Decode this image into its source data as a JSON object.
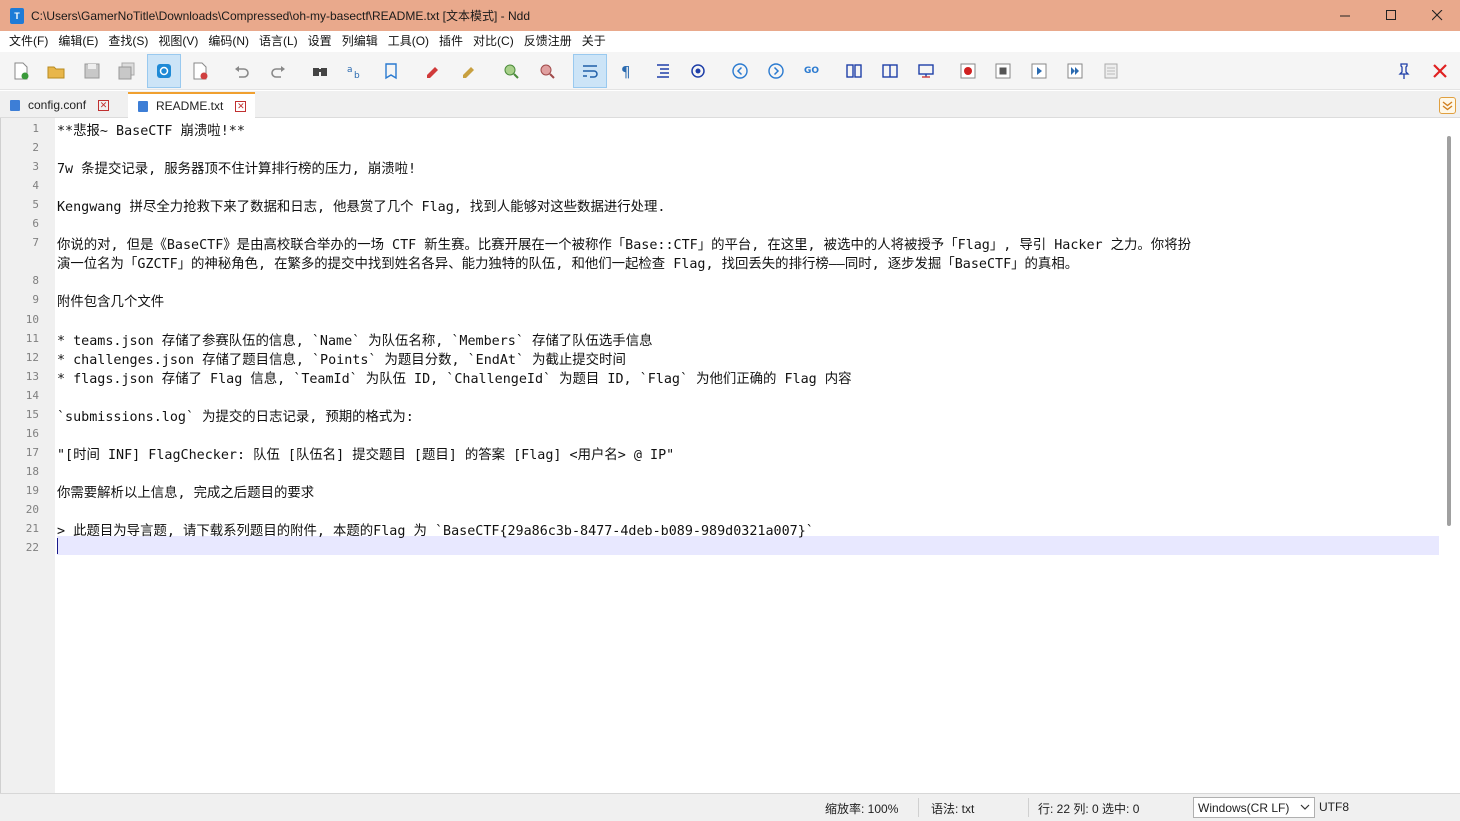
{
  "window": {
    "title": "C:\\Users\\GamerNoTitle\\Downloads\\Compressed\\oh-my-basectf\\README.txt [文本模式] - Ndd",
    "app_icon_label": "T"
  },
  "menu": [
    "文件(F)",
    "编辑(E)",
    "查找(S)",
    "视图(V)",
    "编码(N)",
    "语言(L)",
    "设置",
    "列编辑",
    "工具(O)",
    "插件",
    "对比(C)",
    "反馈注册",
    "关于"
  ],
  "tabs": [
    {
      "label": "config.conf",
      "active": false
    },
    {
      "label": "README.txt",
      "active": true
    }
  ],
  "editor": {
    "line_numbers": [
      "1",
      "2",
      "3",
      "4",
      "5",
      "6",
      "7",
      "",
      "8",
      "9",
      "10",
      "11",
      "12",
      "13",
      "14",
      "15",
      "16",
      "17",
      "18",
      "19",
      "20",
      "21",
      "22"
    ],
    "lines": [
      "**悲报~ BaseCTF 崩溃啦!**",
      "",
      "7w 条提交记录, 服务器顶不住计算排行榜的压力, 崩溃啦!",
      "",
      "Kengwang 拼尽全力抢救下来了数据和日志, 他悬赏了几个 Flag, 找到人能够对这些数据进行处理.",
      "",
      "你说的对, 但是《BaseCTF》是由高校联合举办的一场 CTF 新生赛。比赛开展在一个被称作「Base::CTF」的平台, 在这里, 被选中的人将被授予「Flag」, 导引 Hacker 之力。你将扮",
      "演一位名为「GZCTF」的神秘角色, 在繁多的提交中找到姓名各异、能力独特的队伍, 和他们一起检查 Flag, 找回丢失的排行榜——同时, 逐步发掘「BaseCTF」的真相。",
      "",
      "附件包含几个文件",
      "",
      "* teams.json 存储了参赛队伍的信息, `Name` 为队伍名称, `Members` 存储了队伍选手信息",
      "* challenges.json 存储了题目信息, `Points` 为题目分数, `EndAt` 为截止提交时间",
      "* flags.json 存储了 Flag 信息, `TeamId` 为队伍 ID, `ChallengeId` 为题目 ID, `Flag` 为他们正确的 Flag 内容",
      "",
      "`submissions.log` 为提交的日志记录, 预期的格式为:",
      "",
      "\"[时间 INF] FlagChecker: 队伍 [队伍名] 提交题目 [题目] 的答案 [Flag] <用户名> @ IP\"",
      "",
      "你需要解析以上信息, 完成之后题目的要求",
      "",
      "> 此题目为导言题, 请下载系列题目的附件, 本题的Flag 为 `BaseCTF{29a86c3b-8477-4deb-b089-989d0321a007}`",
      ""
    ]
  },
  "status": {
    "zoom": "缩放率: 100%",
    "syntax": "语法: txt",
    "position": "行: 22 列: 0 选中: 0",
    "line_ending": "Windows(CR LF)",
    "encoding": "UTF8"
  }
}
